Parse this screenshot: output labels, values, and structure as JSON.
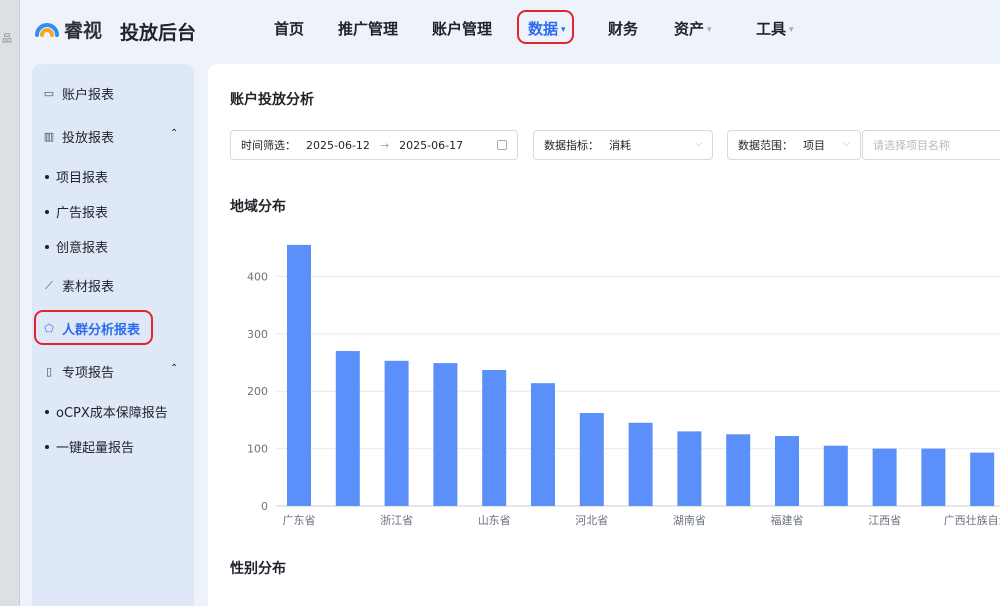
{
  "window": {
    "grip_glyph": "品"
  },
  "brand": {
    "logo_text": "睿视",
    "app_title": "投放后台"
  },
  "nav": {
    "items": [
      {
        "label": "首页",
        "has_caret": false,
        "active": false
      },
      {
        "label": "推广管理",
        "has_caret": false,
        "active": false
      },
      {
        "label": "账户管理",
        "has_caret": false,
        "active": false
      },
      {
        "label": "数据",
        "has_caret": true,
        "active": true
      },
      {
        "label": "财务",
        "has_caret": false,
        "active": false
      },
      {
        "label": "资产",
        "has_caret": true,
        "active": false
      },
      {
        "label": "工具",
        "has_caret": true,
        "active": false
      }
    ],
    "caret_glyph": "▾"
  },
  "sidebar": {
    "account_report": "账户报表",
    "delivery_report": "投放报表",
    "project_report": "项目报表",
    "ad_report": "广告报表",
    "creative_report": "创意报表",
    "material_report": "素材报表",
    "audience_report": "人群分析报表",
    "special_report": "专项报告",
    "ocpx_report": "oCPX成本保障报告",
    "boost_report": "一键起量报告",
    "chevron_glyph": "⌃"
  },
  "main": {
    "page_title": "账户投放分析",
    "filters": {
      "time_label": "时间筛选：",
      "start_date": "2025-06-12",
      "arrow": "→",
      "end_date": "2025-06-17",
      "metric_label": "数据指标：",
      "metric_value": "消耗",
      "scope_label": "数据范围：",
      "scope_value": "项目",
      "project_placeholder": "请选择项目名称",
      "chevron_glyph": "⌵"
    },
    "region_title": "地域分布",
    "gender_title": "性别分布"
  },
  "colors": {
    "accent": "#2f6bf0",
    "bar": "#5b8ff9",
    "highlight": "#e0262c"
  },
  "chart_data": {
    "type": "bar",
    "title": "地域分布",
    "categories": [
      "广东省",
      "",
      "浙江省",
      "",
      "山东省",
      "",
      "河北省",
      "",
      "湖南省",
      "",
      "福建省",
      "",
      "江西省",
      "",
      "广西壮族自治区"
    ],
    "values": [
      455,
      270,
      253,
      249,
      237,
      214,
      162,
      145,
      130,
      125,
      122,
      105,
      100,
      100,
      93
    ],
    "ylim": [
      0,
      460
    ],
    "yticks": [
      0,
      100,
      200,
      300,
      400
    ],
    "grid": true,
    "xlabel": "",
    "ylabel": ""
  }
}
